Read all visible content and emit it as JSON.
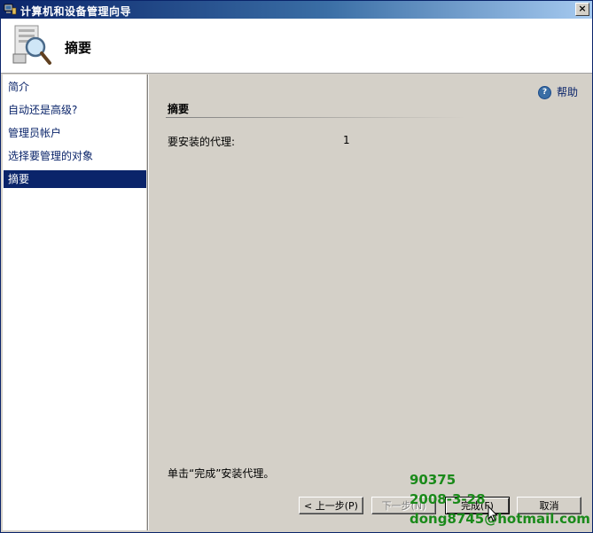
{
  "window": {
    "title": "计算机和设备管理向导",
    "close_label": "×"
  },
  "header": {
    "title": "摘要",
    "icon": "magnifier-computer-icon"
  },
  "sidebar": {
    "items": [
      {
        "label": "简介",
        "active": false
      },
      {
        "label": "自动还是高级?",
        "active": false
      },
      {
        "label": "管理员帐户",
        "active": false
      },
      {
        "label": "选择要管理的对象",
        "active": false
      },
      {
        "label": "摘要",
        "active": true
      }
    ]
  },
  "help": {
    "label": "帮助",
    "icon": "help-icon"
  },
  "main": {
    "section_title": "摘要",
    "rows": [
      {
        "label": "要安装的代理:",
        "value": "1"
      }
    ],
    "footer_note": "单击“完成”安装代理。"
  },
  "buttons": {
    "back": "< 上一步(P)",
    "next": "下一步(N)",
    "finish": "完成(F)",
    "cancel": "取消"
  },
  "watermark": {
    "line1": "90375",
    "line2": "2008-3-28",
    "line3": "dong8745@hotmail.com"
  },
  "colors": {
    "selection": "#0a246a",
    "watermark": "#1a8a1a",
    "dialog_bg": "#d4d0c8"
  }
}
